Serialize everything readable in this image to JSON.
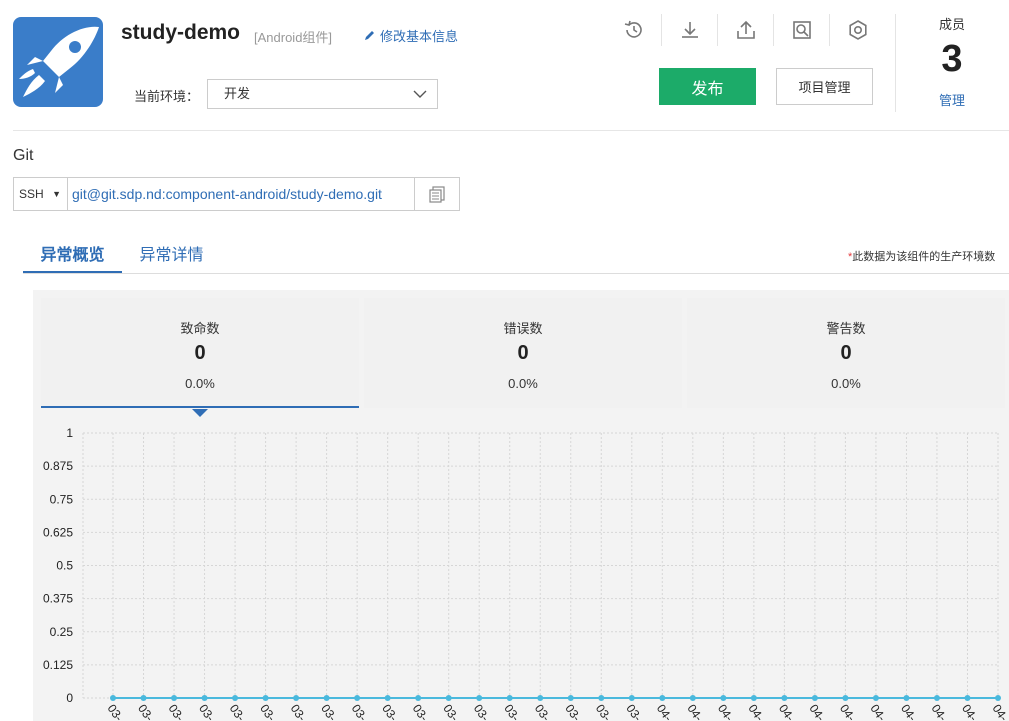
{
  "header": {
    "project_name": "study-demo",
    "project_type": "[Android组件]",
    "edit_label": "修改基本信息",
    "env_label": "当前环境：",
    "env_value": "开发",
    "publish_label": "发布",
    "manage_label": "项目管理",
    "logo_icon": "rocket-icon",
    "toolbar": [
      "history-icon",
      "download-icon",
      "upload-icon",
      "search-doc-icon",
      "settings-icon"
    ]
  },
  "members": {
    "title": "成员",
    "count": "3",
    "manage_link": "管理"
  },
  "git": {
    "label": "Git",
    "protocol": "SSH",
    "url": "git@git.sdp.nd:component-android/study-demo.git"
  },
  "tabs": [
    "异常概览",
    "异常详情"
  ],
  "note": {
    "star": "*",
    "text": "此数据为该组件的生产环境数"
  },
  "cards": [
    {
      "title": "致命数",
      "value": "0",
      "pct": "0.0%"
    },
    {
      "title": "错误数",
      "value": "0",
      "pct": "0.0%"
    },
    {
      "title": "警告数",
      "value": "0",
      "pct": "0.0%"
    }
  ],
  "colors": {
    "accent": "#2f6db5",
    "publish": "#1cab69",
    "series": "#4ab9dd",
    "logo": "#3a7dc9"
  },
  "chart_data": {
    "type": "line",
    "title": "",
    "ylim": [
      0,
      1
    ],
    "y_ticks": [
      "1",
      "0.875",
      "0.75",
      "0.625",
      "0.5",
      "0.375",
      "0.25",
      "0.125",
      "0"
    ],
    "x_tick_labels": [
      "03-",
      "03-",
      "03-",
      "03-",
      "03-",
      "03-",
      "03-",
      "03-",
      "03-",
      "03-",
      "03-",
      "03-",
      "03-",
      "03-",
      "03-",
      "03-",
      "03-",
      "03-",
      "04-",
      "04-",
      "04-",
      "04-",
      "04-",
      "04-",
      "04-",
      "04-",
      "04-",
      "04-",
      "04-",
      "04-"
    ],
    "series": [
      {
        "values": [
          0,
          0,
          0,
          0,
          0,
          0,
          0,
          0,
          0,
          0,
          0,
          0,
          0,
          0,
          0,
          0,
          0,
          0,
          0,
          0,
          0,
          0,
          0,
          0,
          0,
          0,
          0,
          0,
          0,
          0
        ]
      }
    ],
    "grid": true
  }
}
